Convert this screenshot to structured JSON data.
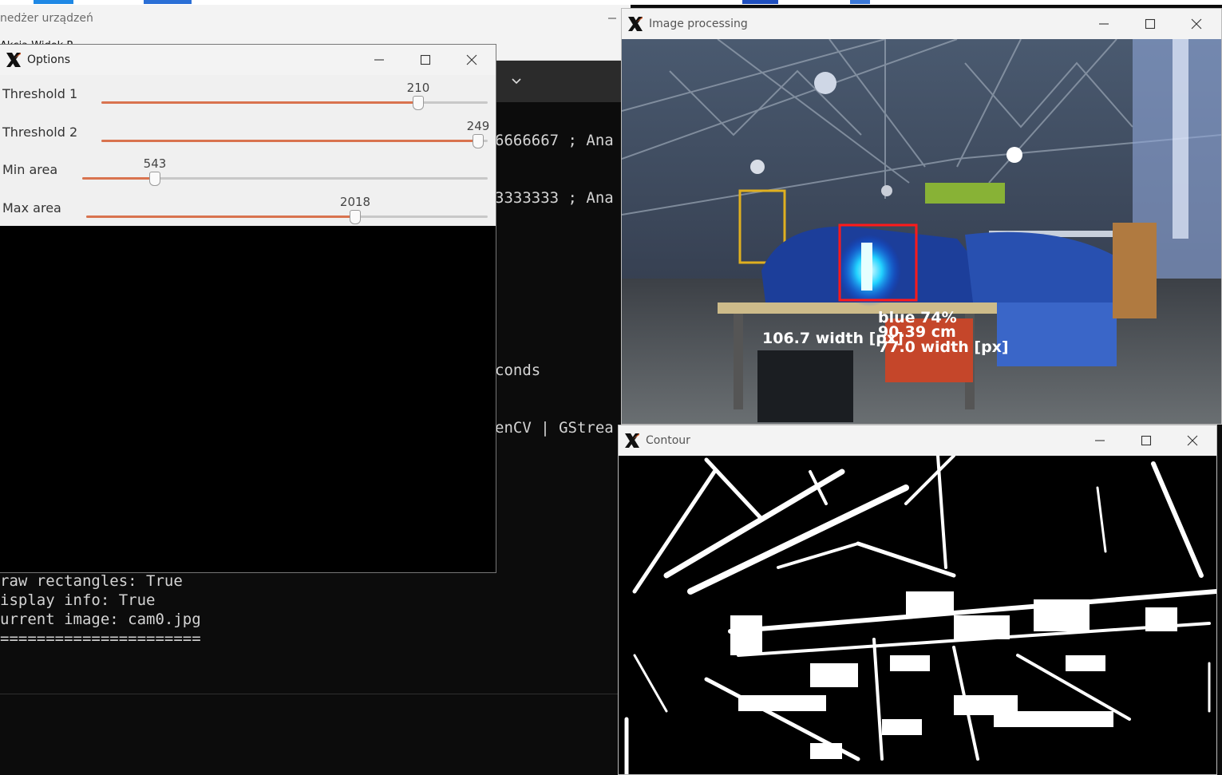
{
  "device_manager": {
    "title": "nedżer urządzeń",
    "menu": "Akcja  Widok  P"
  },
  "terminal": {
    "lines_right": [
      {
        "text": "6666667 ; Ana"
      },
      {
        "text": "3333333 ; Ana"
      },
      {
        "text": "conds"
      },
      {
        "text": "enCV | GStrea"
      }
    ],
    "lines_bottom": [
      {
        "text": "raw rectangles: True"
      },
      {
        "text": "isplay info: True"
      },
      {
        "text": "urrent image: cam0.jpg"
      },
      {
        "text": "======================"
      }
    ]
  },
  "options": {
    "title": "Options",
    "trackbars": [
      {
        "label": "Threshold 1",
        "value": "210",
        "fraction": 0.82
      },
      {
        "label": "Threshold 2",
        "value": "249",
        "fraction": 0.976
      },
      {
        "label": "Min area",
        "value": "543",
        "fraction": 0.18
      },
      {
        "label": "Max area",
        "value": "2018",
        "fraction": 0.67
      }
    ]
  },
  "image_processing": {
    "title": "Image processing",
    "overlay": {
      "color_label": "blue 74%",
      "distance": "90.39 cm",
      "width_left": "106.7 width [px]",
      "width_right": "77.0 width [px]"
    },
    "bbox_color": "#ff1a1a"
  },
  "contour": {
    "title": "Contour"
  },
  "colors": {
    "slider_fill": "#d9734f",
    "terminal_bg": "#0c0c0c",
    "titlebar_bg": "#f3f3f3"
  },
  "icons": [
    "x-app-icon",
    "minimize-icon",
    "maximize-icon",
    "close-icon",
    "chevron-down-icon"
  ]
}
